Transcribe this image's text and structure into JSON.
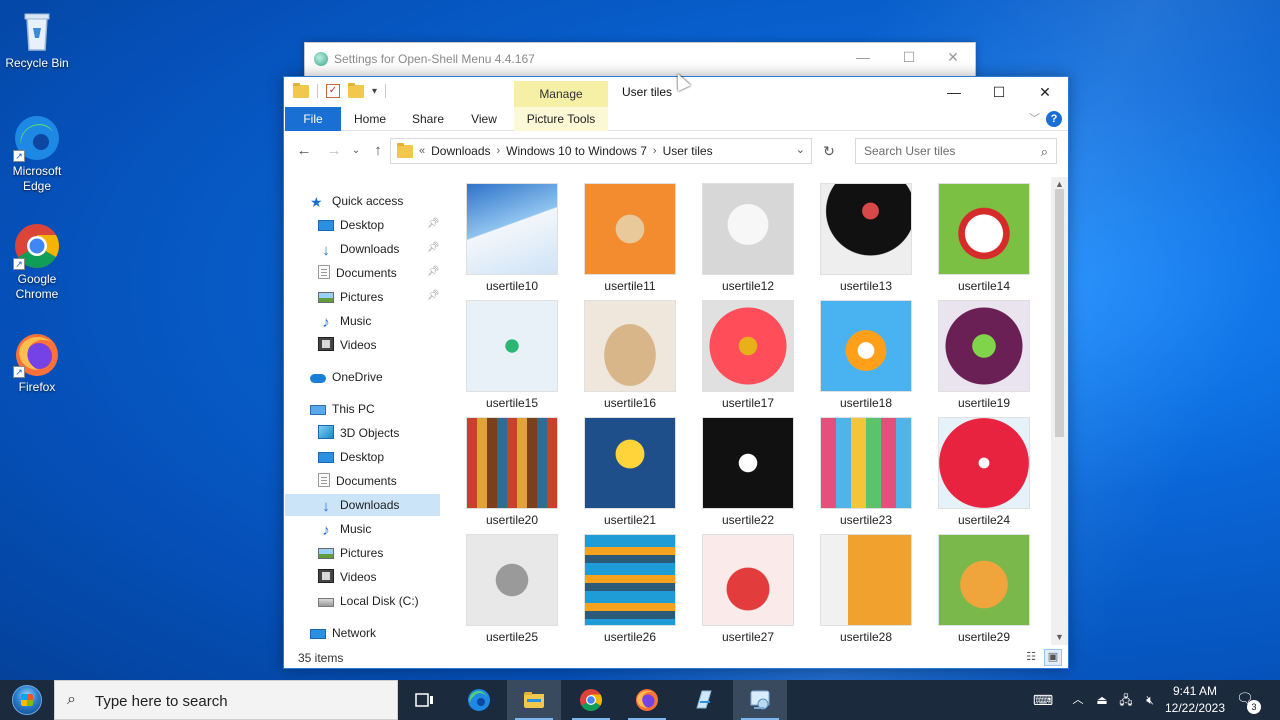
{
  "desktop": {
    "icons": [
      {
        "label": "Recycle Bin"
      },
      {
        "label": "Microsoft Edge"
      },
      {
        "label": "Google Chrome"
      },
      {
        "label": "Firefox"
      }
    ]
  },
  "settings_window": {
    "title": "Settings for Open-Shell Menu 4.4.167"
  },
  "explorer": {
    "title": "User tiles",
    "contextual_tab": "Manage",
    "ribbon_tabs": [
      "File",
      "Home",
      "Share",
      "View",
      "Picture Tools"
    ],
    "breadcrumb": {
      "overflow": "«",
      "items": [
        "Downloads",
        "Windows 10 to Windows 7",
        "User tiles"
      ]
    },
    "search_placeholder": "Search User tiles",
    "sidebar": {
      "quick_access": "Quick access",
      "quick_items": [
        "Desktop",
        "Downloads",
        "Documents",
        "Pictures",
        "Music",
        "Videos"
      ],
      "onedrive": "OneDrive",
      "this_pc": "This PC",
      "pc_items": [
        "3D Objects",
        "Desktop",
        "Documents",
        "Downloads",
        "Music",
        "Pictures",
        "Videos",
        "Local Disk (C:)"
      ],
      "network": "Network",
      "selected": "Downloads"
    },
    "files": [
      {
        "name": "usertile10"
      },
      {
        "name": "usertile11"
      },
      {
        "name": "usertile12"
      },
      {
        "name": "usertile13"
      },
      {
        "name": "usertile14"
      },
      {
        "name": "usertile15"
      },
      {
        "name": "usertile16"
      },
      {
        "name": "usertile17"
      },
      {
        "name": "usertile18"
      },
      {
        "name": "usertile19"
      },
      {
        "name": "usertile20"
      },
      {
        "name": "usertile21"
      },
      {
        "name": "usertile22"
      },
      {
        "name": "usertile23"
      },
      {
        "name": "usertile24"
      },
      {
        "name": "usertile25"
      },
      {
        "name": "usertile26"
      },
      {
        "name": "usertile27"
      },
      {
        "name": "usertile28"
      },
      {
        "name": "usertile29"
      }
    ],
    "status": "35 items"
  },
  "taskbar": {
    "search_placeholder": "Type here to search",
    "time": "9:41 AM",
    "date": "12/22/2023",
    "notification_count": "3"
  },
  "colors": {
    "accent": "#1a6fd4",
    "manage_tab": "#f5f0a6",
    "taskbar": "#1b2a3d"
  }
}
